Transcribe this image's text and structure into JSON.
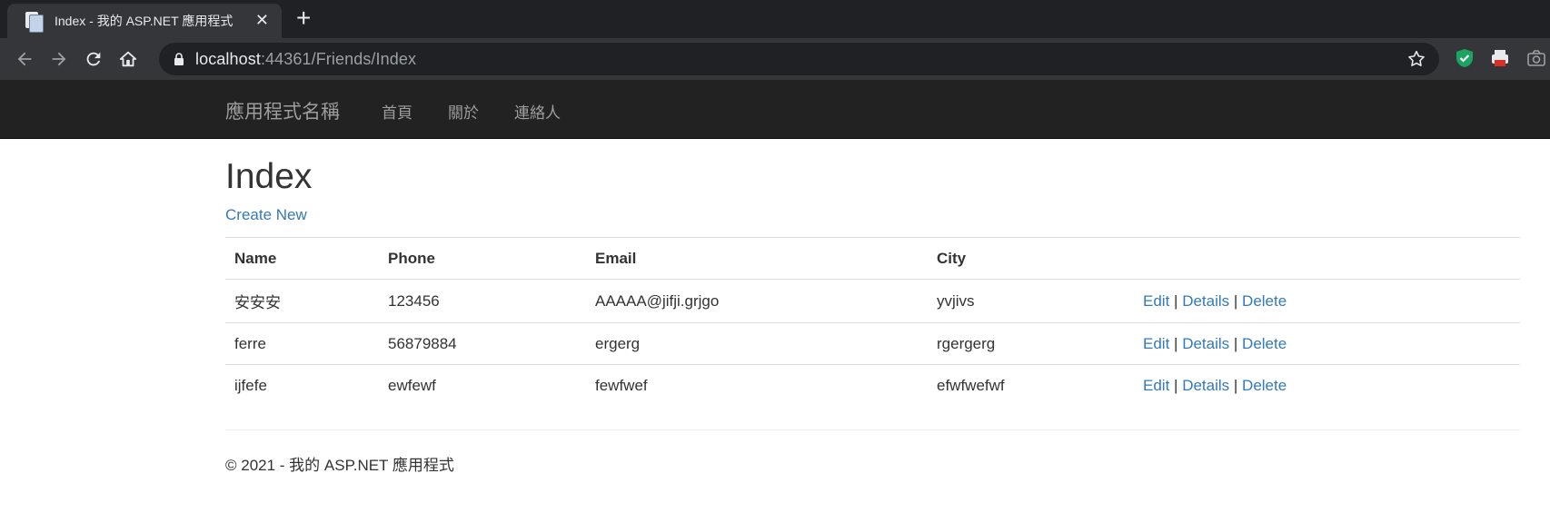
{
  "browser": {
    "tab_title": "Index - 我的 ASP.NET 應用程式",
    "url_host": "localhost",
    "url_path": ":44361/Friends/Index"
  },
  "site": {
    "brand": "應用程式名稱",
    "nav": [
      "首頁",
      "關於",
      "連絡人"
    ]
  },
  "page": {
    "title": "Index",
    "create_link": "Create New",
    "columns": [
      "Name",
      "Phone",
      "Email",
      "City"
    ],
    "rows": [
      {
        "name": "安安安",
        "phone": "123456",
        "email": "AAAAA@jifji.grjgo",
        "city": "yvjivs"
      },
      {
        "name": "ferre",
        "phone": "56879884",
        "email": "ergerg",
        "city": "rgergerg"
      },
      {
        "name": "ijfefe",
        "phone": "ewfewf",
        "email": "fewfwef",
        "city": "efwfwefwf"
      }
    ],
    "actions": {
      "edit": "Edit",
      "details": "Details",
      "delete": "Delete",
      "separator": "|"
    }
  },
  "footer": {
    "text": "© 2021 - 我的 ASP.NET 應用程式"
  },
  "colors": {
    "link": "#337ab7",
    "navbar": "#222222",
    "chrome": "#35363a"
  }
}
